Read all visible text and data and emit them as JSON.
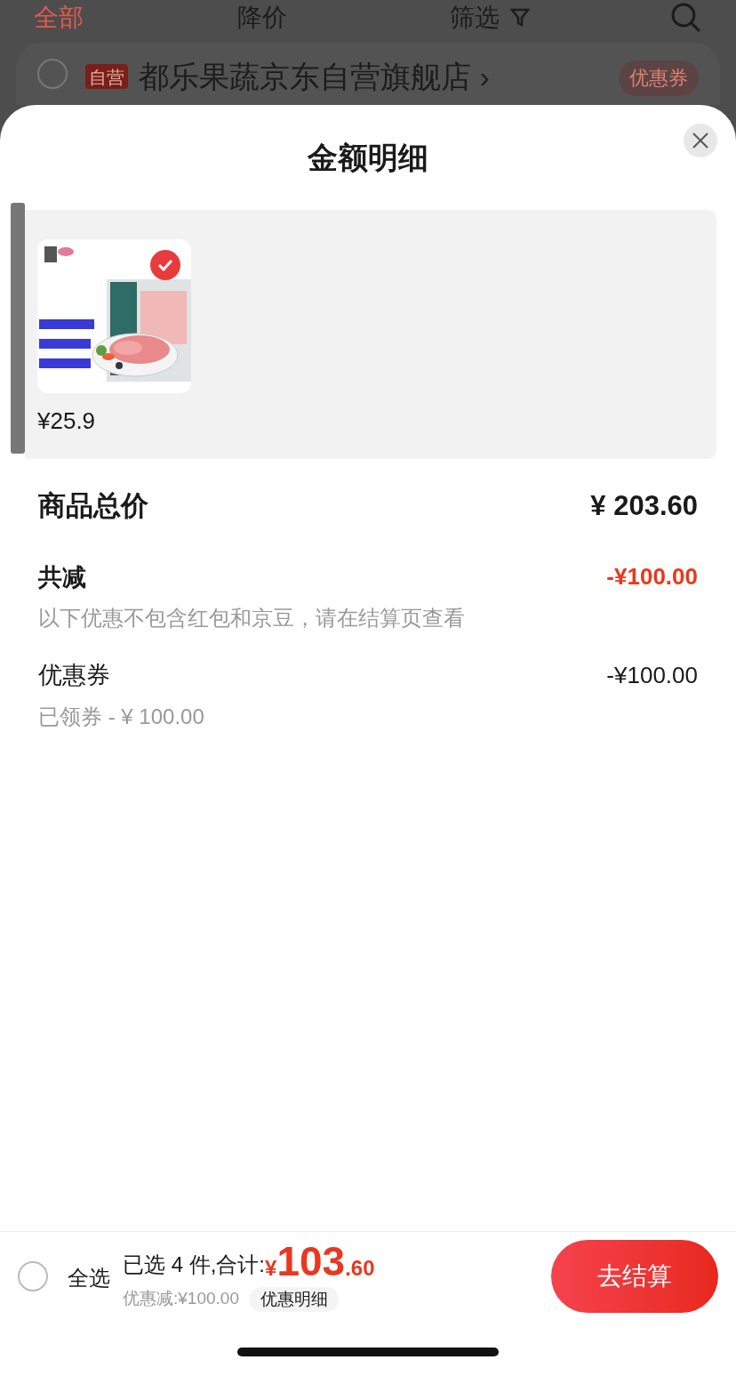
{
  "background": {
    "tabs": [
      {
        "label": "全部",
        "selected": true
      },
      {
        "label": "降价",
        "selected": false
      },
      {
        "label": "筛选",
        "selected": false
      }
    ],
    "store": {
      "checked": false,
      "badge": "自营",
      "name": "都乐果蔬京东自营旗舰店 ›",
      "coupon": "优惠券"
    }
  },
  "sheet": {
    "title": "金额明细",
    "products": [
      {
        "price": "¥25.9",
        "selected": true
      }
    ],
    "rows": [
      {
        "kind": "total",
        "label": "商品总价",
        "amount": "¥ 203.60"
      },
      {
        "kind": "discount",
        "label": "共减",
        "amount": "-¥100.00",
        "note": "以下优惠不包含红包和京豆，请在结算页查看"
      },
      {
        "kind": "item",
        "label": "优惠券",
        "amount": "-¥100.00",
        "note": "已领券 - ¥ 100.00"
      }
    ]
  },
  "footer": {
    "select_all": {
      "label": "全选",
      "checked": false
    },
    "summary": "已选 4 件,合计:",
    "currency": "¥",
    "total_int": "103",
    "total_dec": ".60",
    "discount": "优惠减:¥100.00",
    "detail_button": "优惠明细",
    "checkout": "去结算"
  }
}
